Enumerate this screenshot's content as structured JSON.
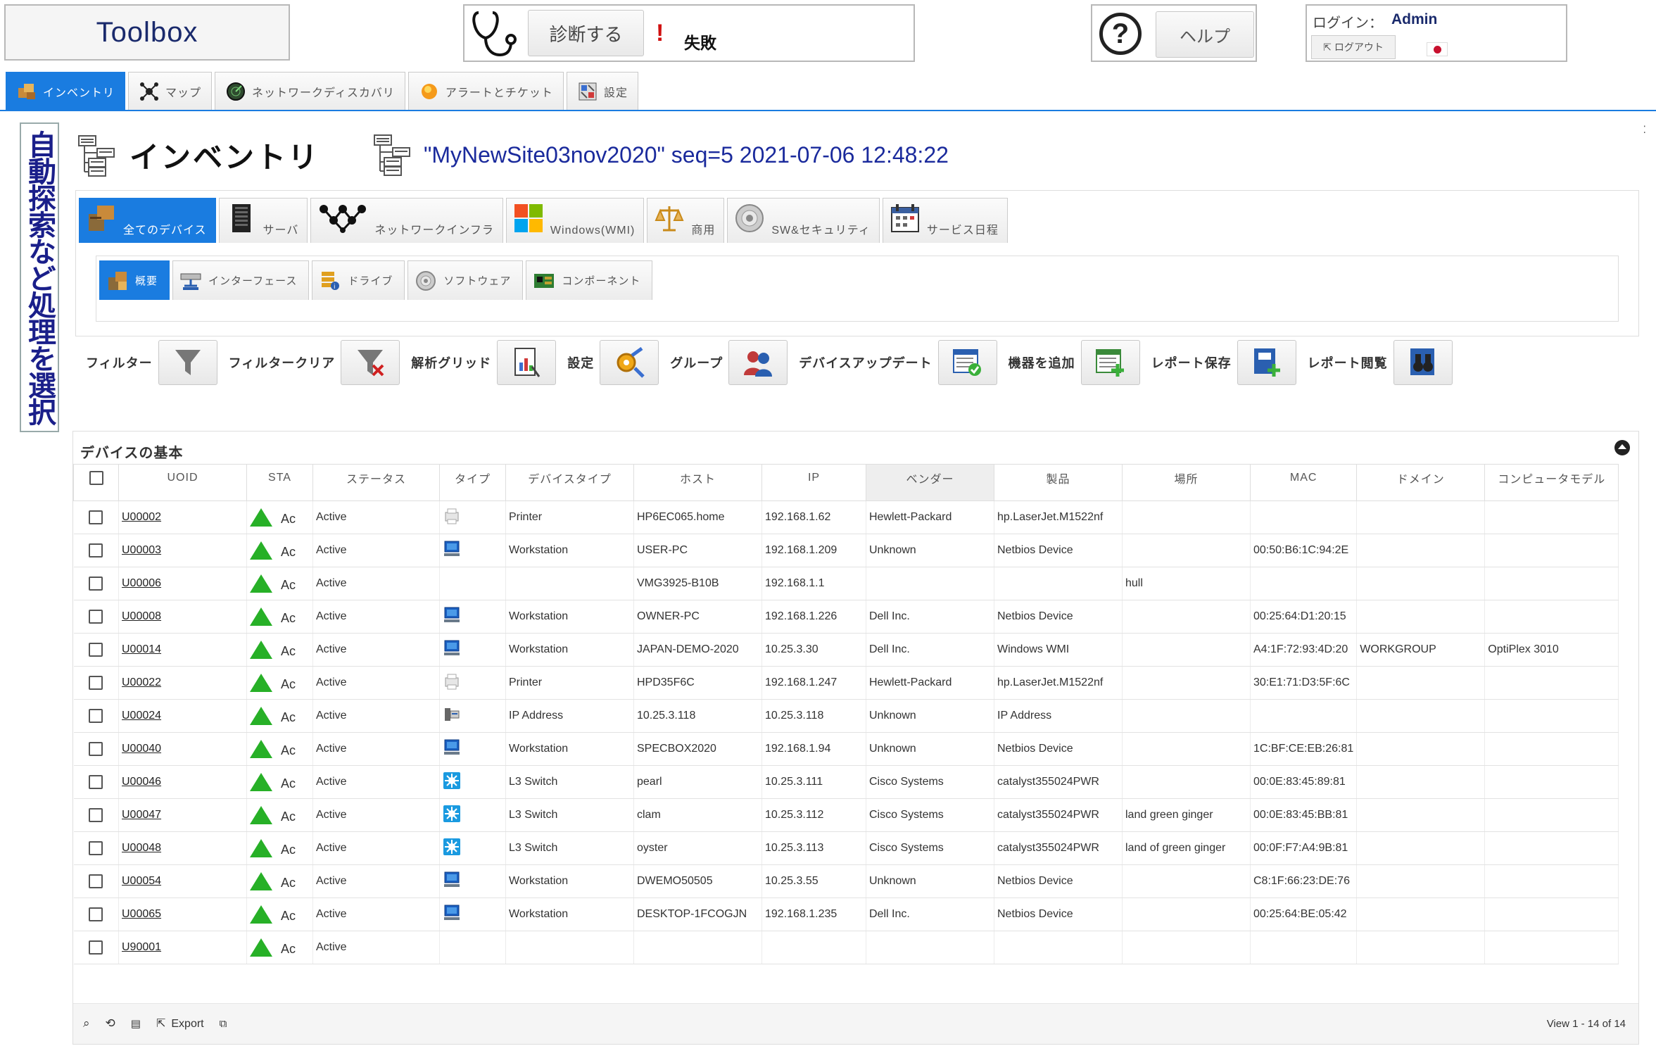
{
  "header": {
    "app_title": "Toolbox",
    "diagnose_label": "診断する",
    "diagnose_status": "失敗",
    "help_label": "ヘルプ",
    "login_label": "ログイン：",
    "login_user": "Admin",
    "logout_label": "ログアウト"
  },
  "main_tabs": [
    {
      "label": "インベントリ",
      "active": true
    },
    {
      "label": "マップ"
    },
    {
      "label": "ネットワークディスカバリ"
    },
    {
      "label": "アラートとチケット"
    },
    {
      "label": "設定"
    }
  ],
  "side_label": "自動探索など処理を選択",
  "page": {
    "title": "インベントリ",
    "site_title": "\"MyNewSite03nov2020\" seq=5 2021-07-06 12:48:22"
  },
  "category_tabs": [
    {
      "label": "全てのデバイス",
      "active": true
    },
    {
      "label": "サーバ"
    },
    {
      "label": "ネットワークインフラ"
    },
    {
      "label": "Windows(WMI)"
    },
    {
      "label": "商用"
    },
    {
      "label": "SW&セキュリティ"
    },
    {
      "label": "サービス日程"
    }
  ],
  "sub_tabs": [
    {
      "label": "概要",
      "active": true
    },
    {
      "label": "インターフェース"
    },
    {
      "label": "ドライブ"
    },
    {
      "label": "ソフトウェア"
    },
    {
      "label": "コンポーネント"
    }
  ],
  "toolbar": [
    {
      "label": "フィルター"
    },
    {
      "label": "フィルタークリア"
    },
    {
      "label": "解析グリッド"
    },
    {
      "label": "設定"
    },
    {
      "label": "グループ"
    },
    {
      "label": "デバイスアップデート"
    },
    {
      "label": "機器を追加"
    },
    {
      "label": "レポート保存"
    },
    {
      "label": "レポート閲覧"
    }
  ],
  "grid": {
    "caption": "デバイスの基本",
    "columns": [
      "UOID",
      "STA",
      "ステータス",
      "タイプ",
      "デバイスタイプ",
      "ホスト",
      "IP",
      "ベンダー",
      "製品",
      "場所",
      "MAC",
      "ドメイン",
      "コンピュータモデル"
    ],
    "sta_text": "Ac",
    "rows": [
      {
        "uoid": "U00002",
        "status": "Active",
        "icon": "printer-icon",
        "dtype": "Printer",
        "host": "HP6EC065.home",
        "ip": "192.168.1.62",
        "vendor": "Hewlett-Packard",
        "product": "hp.LaserJet.M1522nf",
        "location": "",
        "mac": "",
        "domain": "",
        "model": ""
      },
      {
        "uoid": "U00003",
        "status": "Active",
        "icon": "workstation-icon",
        "dtype": "Workstation",
        "host": "USER-PC",
        "ip": "192.168.1.209",
        "vendor": "Unknown",
        "product": "Netbios Device",
        "location": "",
        "mac": "00:50:B6:1C:94:2E",
        "domain": "",
        "model": ""
      },
      {
        "uoid": "U00006",
        "status": "Active",
        "icon": "",
        "dtype": "",
        "host": "VMG3925-B10B",
        "ip": "192.168.1.1",
        "vendor": "",
        "product": "",
        "location": "hull",
        "mac": "",
        "domain": "",
        "model": ""
      },
      {
        "uoid": "U00008",
        "status": "Active",
        "icon": "workstation-icon",
        "dtype": "Workstation",
        "host": "OWNER-PC",
        "ip": "192.168.1.226",
        "vendor": "Dell Inc.",
        "product": "Netbios Device",
        "location": "",
        "mac": "00:25:64:D1:20:15",
        "domain": "",
        "model": ""
      },
      {
        "uoid": "U00014",
        "status": "Active",
        "icon": "workstation-icon",
        "dtype": "Workstation",
        "host": "JAPAN-DEMO-2020",
        "ip": "10.25.3.30",
        "vendor": "Dell Inc.",
        "product": "Windows WMI",
        "location": "",
        "mac": "A4:1F:72:93:4D:20",
        "domain": "WORKGROUP",
        "model": "OptiPlex 3010"
      },
      {
        "uoid": "U00022",
        "status": "Active",
        "icon": "printer-icon",
        "dtype": "Printer",
        "host": "HPD35F6C",
        "ip": "192.168.1.247",
        "vendor": "Hewlett-Packard",
        "product": "hp.LaserJet.M1522nf",
        "location": "",
        "mac": "30:E1:71:D3:5F:6C",
        "domain": "",
        "model": ""
      },
      {
        "uoid": "U00024",
        "status": "Active",
        "icon": "ip-address-icon",
        "dtype": "IP Address",
        "host": "10.25.3.118",
        "ip": "10.25.3.118",
        "vendor": "Unknown",
        "product": "IP Address",
        "location": "",
        "mac": "",
        "domain": "",
        "model": ""
      },
      {
        "uoid": "U00040",
        "status": "Active",
        "icon": "workstation-icon",
        "dtype": "Workstation",
        "host": "SPECBOX2020",
        "ip": "192.168.1.94",
        "vendor": "Unknown",
        "product": "Netbios Device",
        "location": "",
        "mac": "1C:BF:CE:EB:26:81",
        "domain": "",
        "model": ""
      },
      {
        "uoid": "U00046",
        "status": "Active",
        "icon": "switch-icon",
        "dtype": "L3 Switch",
        "host": "pearl",
        "ip": "10.25.3.111",
        "vendor": "Cisco Systems",
        "product": "catalyst355024PWR",
        "location": "",
        "mac": "00:0E:83:45:89:81",
        "domain": "",
        "model": ""
      },
      {
        "uoid": "U00047",
        "status": "Active",
        "icon": "switch-icon",
        "dtype": "L3 Switch",
        "host": "clam",
        "ip": "10.25.3.112",
        "vendor": "Cisco Systems",
        "product": "catalyst355024PWR",
        "location": "land green ginger",
        "mac": "00:0E:83:45:BB:81",
        "domain": "",
        "model": ""
      },
      {
        "uoid": "U00048",
        "status": "Active",
        "icon": "switch-icon",
        "dtype": "L3 Switch",
        "host": "oyster",
        "ip": "10.25.3.113",
        "vendor": "Cisco Systems",
        "product": "catalyst355024PWR",
        "location": "land of green ginger",
        "mac": "00:0F:F7:A4:9B:81",
        "domain": "",
        "model": ""
      },
      {
        "uoid": "U00054",
        "status": "Active",
        "icon": "workstation-icon",
        "dtype": "Workstation",
        "host": "DWEMO50505",
        "ip": "10.25.3.55",
        "vendor": "Unknown",
        "product": "Netbios Device",
        "location": "",
        "mac": "C8:1F:66:23:DE:76",
        "domain": "",
        "model": ""
      },
      {
        "uoid": "U00065",
        "status": "Active",
        "icon": "workstation-icon",
        "dtype": "Workstation",
        "host": "DESKTOP-1FCOGJN",
        "ip": "192.168.1.235",
        "vendor": "Dell Inc.",
        "product": "Netbios Device",
        "location": "",
        "mac": "00:25:64:BE:05:42",
        "domain": "",
        "model": ""
      },
      {
        "uoid": "U90001",
        "status": "Active",
        "icon": "",
        "dtype": "",
        "host": "",
        "ip": "",
        "vendor": "",
        "product": "",
        "location": "",
        "mac": "",
        "domain": "",
        "model": ""
      }
    ],
    "footer": {
      "export_label": "Export",
      "view_text": "View 1 - 14 of 14"
    }
  },
  "colors": {
    "accent": "#1a7ce0",
    "status_ok": "#27b027",
    "title_navy": "#1a2a6c",
    "site_blue": "#1a2a9c"
  }
}
